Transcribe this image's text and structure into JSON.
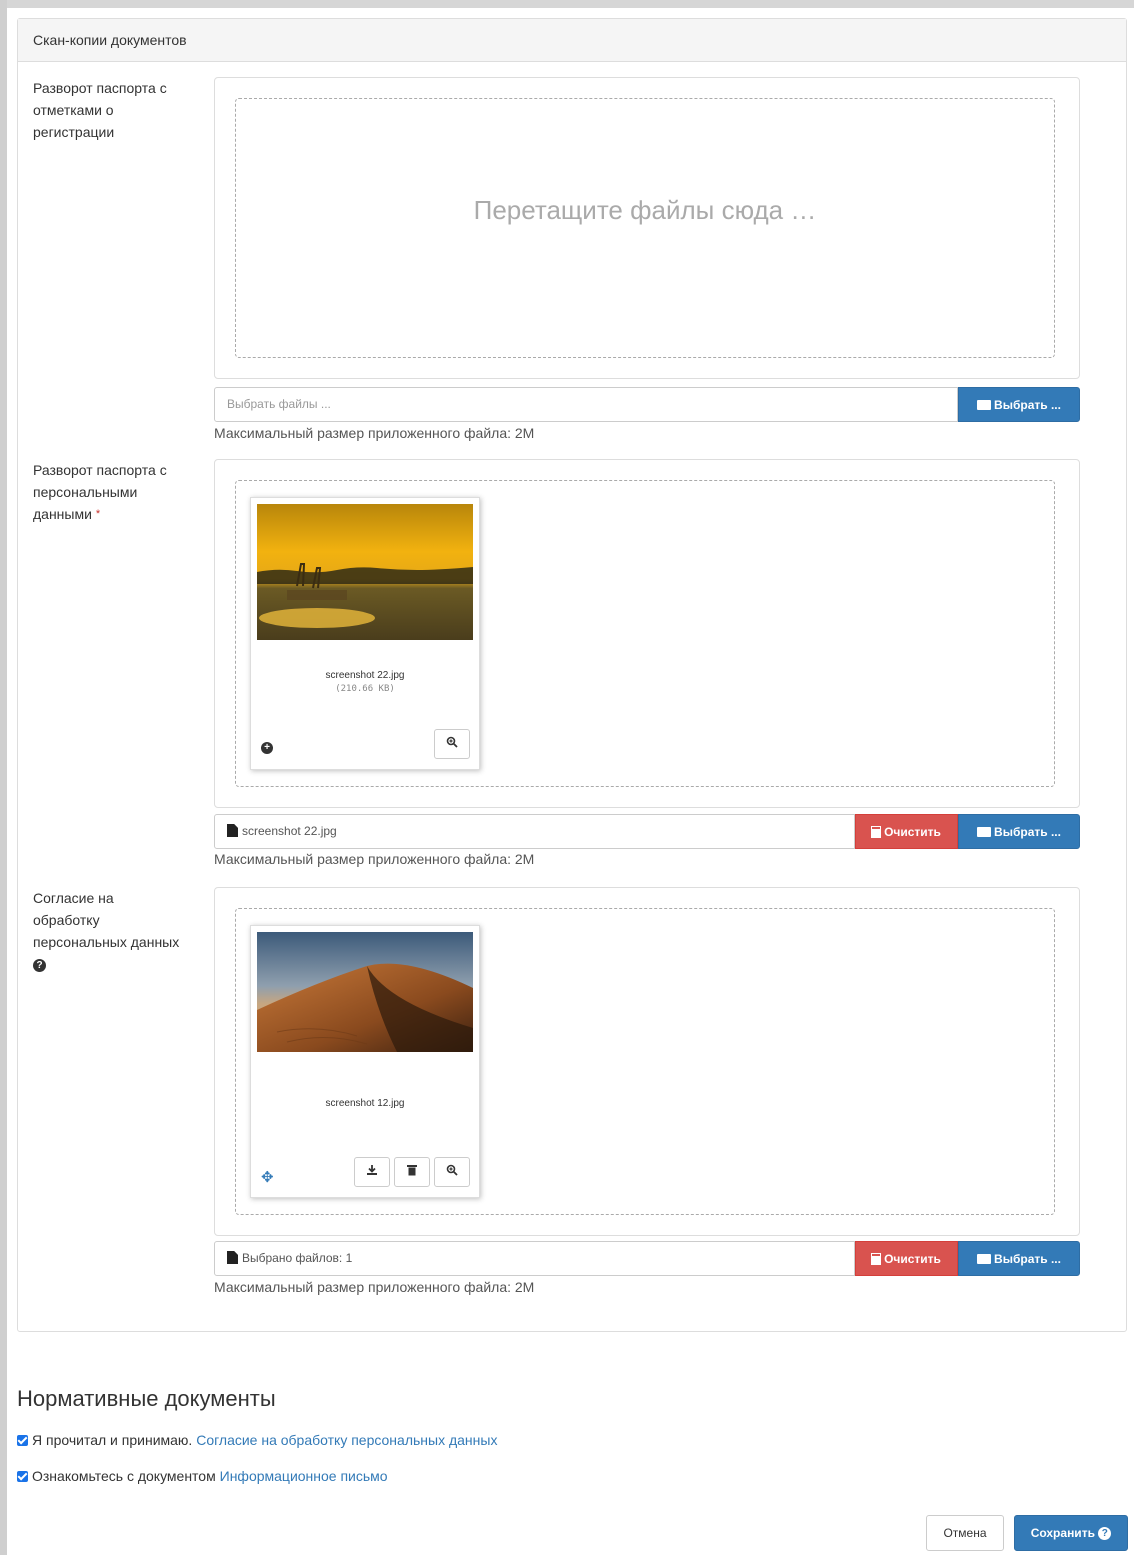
{
  "panel": {
    "heading": "Скан-копии документов"
  },
  "fields": [
    {
      "label": "Разворот паспорта с отметками о регистрации",
      "drop_text": "Перетащите файлы сюда …",
      "input_text": "Выбрать файлы ...",
      "browse_label": "Выбрать ...",
      "hint": "Максимальный размер приложенного файла: 2M"
    },
    {
      "label": "Разворот паспорта с персональными данными",
      "required_mark": "*",
      "thumb_name": "screenshot 22.jpg",
      "thumb_size": "(210.66 KB)",
      "input_text": "screenshot 22.jpg",
      "clear_label": "Очистить",
      "browse_label": "Выбрать ...",
      "hint": "Максимальный размер приложенного файла: 2M"
    },
    {
      "label": "Согласие на обработку персональных данных",
      "thumb_name": "screenshot 12.jpg",
      "input_text": "Выбрано файлов: 1",
      "clear_label": "Очистить",
      "browse_label": "Выбрать ...",
      "hint": "Максимальный размер приложенного файла: 2M"
    }
  ],
  "normative": {
    "title": "Нормативные документы",
    "items": [
      {
        "text": "Я прочитал и принимаю.",
        "link": "Согласие на обработку персональных данных",
        "checked": true
      },
      {
        "text": "Ознакомьтесь с документом",
        "link": "Информационное письмо",
        "checked": true
      }
    ]
  },
  "actions": {
    "cancel_label": "Отмена",
    "save_label": "Сохранить"
  },
  "colors": {
    "primary": "#337ab7",
    "danger": "#d9534f",
    "panel_heading_bg": "#f5f5f5"
  },
  "icons": [
    "folder-open-icon",
    "trash-icon",
    "file-icon",
    "zoom-in-icon",
    "download-icon",
    "move-icon",
    "plus-circle-icon",
    "question-circle-icon",
    "checkbox-checked-icon"
  ]
}
